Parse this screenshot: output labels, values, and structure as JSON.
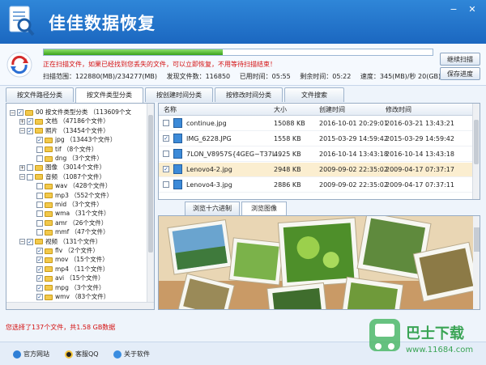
{
  "app": {
    "title": "佳佳数据恢复"
  },
  "window": {
    "minimize": "−",
    "close": "✕"
  },
  "scan": {
    "progress": 0.46,
    "message": "正在扫描文件，如果已经找到您丢失的文件，可以立即恢复，不用等待扫描结束！",
    "range": "扫描范围：122880(MB)/234277(MB)",
    "found": "发现文件数：116850",
    "elapsed": "已用时间：05:55",
    "remaining": "剩余时间：05:22",
    "speed": "速度：345(MB)/秒 20(GB)/分钟",
    "continue_label": "继续扫描",
    "save_label": "保存进度"
  },
  "tabs": [
    "按文件路径分类",
    "按文件类型分类",
    "按创建时间分类",
    "按修改时间分类",
    "文件搜索"
  ],
  "tree": [
    {
      "label": "00 按文件类型分类 （113609个文",
      "level": 0,
      "toggle": "−",
      "checked": true
    },
    {
      "label": "文档 （47186个文件）",
      "level": 1,
      "toggle": "+",
      "checked": true
    },
    {
      "label": "照片 （13454个文件）",
      "level": 1,
      "toggle": "−",
      "checked": true
    },
    {
      "label": "jpg （13443个文件）",
      "level": 2,
      "toggle": "",
      "checked": true
    },
    {
      "label": "tif （8个文件）",
      "level": 2,
      "toggle": "",
      "checked": false
    },
    {
      "label": "dng （3个文件）",
      "level": 2,
      "toggle": "",
      "checked": false
    },
    {
      "label": "图像 （3014个文件）",
      "level": 1,
      "toggle": "+",
      "checked": false
    },
    {
      "label": "音频 （1087个文件）",
      "level": 1,
      "toggle": "−",
      "checked": false
    },
    {
      "label": "wav （428个文件）",
      "level": 2,
      "toggle": "",
      "checked": false
    },
    {
      "label": "mp3 （552个文件）",
      "level": 2,
      "toggle": "",
      "checked": false
    },
    {
      "label": "mid （3个文件）",
      "level": 2,
      "toggle": "",
      "checked": false
    },
    {
      "label": "wma （31个文件）",
      "level": 2,
      "toggle": "",
      "checked": false
    },
    {
      "label": "amr （26个文件）",
      "level": 2,
      "toggle": "",
      "checked": false
    },
    {
      "label": "mmf （47个文件）",
      "level": 2,
      "toggle": "",
      "checked": false
    },
    {
      "label": "视频 （131个文件）",
      "level": 1,
      "toggle": "−",
      "checked": true
    },
    {
      "label": "flv （2个文件）",
      "level": 2,
      "toggle": "",
      "checked": true
    },
    {
      "label": "mov （15个文件）",
      "level": 2,
      "toggle": "",
      "checked": true
    },
    {
      "label": "mp4 （11个文件）",
      "level": 2,
      "toggle": "",
      "checked": true
    },
    {
      "label": "avi （15个文件）",
      "level": 2,
      "toggle": "",
      "checked": true
    },
    {
      "label": "mpg （3个文件）",
      "level": 2,
      "toggle": "",
      "checked": true
    },
    {
      "label": "wmv （83个文件）",
      "level": 2,
      "toggle": "",
      "checked": true
    }
  ],
  "files": {
    "headers": [
      "名称",
      "大小",
      "创建时间",
      "修改时间"
    ],
    "rows": [
      {
        "name": "continue.jpg",
        "size": "15088 KB",
        "created": "2016-10-01 20:29:01",
        "modified": "2016-03-21 13:43:21",
        "checked": false,
        "selected": false
      },
      {
        "name": "IMG_6228.JPG",
        "size": "1558 KB",
        "created": "2015-03-29 14:59:42",
        "modified": "2015-03-29 14:59:42",
        "checked": true,
        "selected": false
      },
      {
        "name": "7LON_V8957S{4GEG~T37L...",
        "size": "4925 KB",
        "created": "2016-10-14 13:43:18",
        "modified": "2016-10-14 13:43:18",
        "checked": false,
        "selected": false
      },
      {
        "name": "Lenovo4-2.jpg",
        "size": "2948 KB",
        "created": "2009-09-02 22:35:02",
        "modified": "2009-04-17 07:37:17",
        "checked": true,
        "selected": true
      },
      {
        "name": "Lenovo4-3.jpg",
        "size": "2886 KB",
        "created": "2009-09-02 22:35:02",
        "modified": "2009-04-17 07:37:11",
        "checked": false,
        "selected": false
      }
    ]
  },
  "preview_tabs": [
    "浏览十六进制",
    "浏览图像"
  ],
  "summary": "您选择了137个文件，共1.58 GB数据",
  "bottom_links": [
    "官方网站",
    "客服QQ",
    "关于软件"
  ],
  "watermark": {
    "cn": "巴士下载",
    "url": "www.11684.com"
  }
}
